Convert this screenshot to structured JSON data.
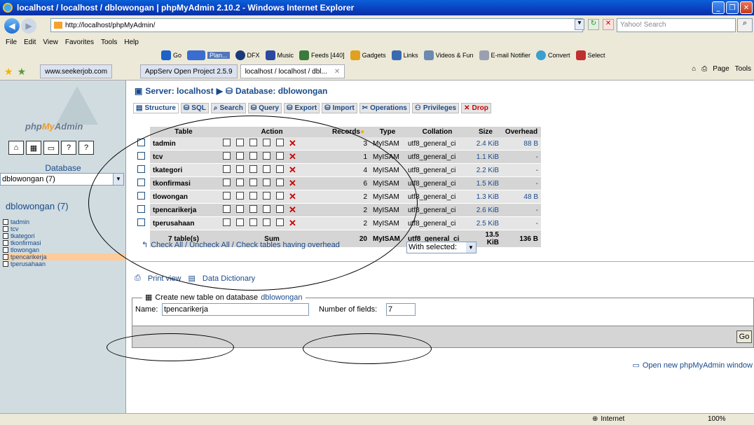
{
  "window": {
    "title": "localhost / localhost / dblowongan | phpMyAdmin 2.10.2 - Windows Internet Explorer"
  },
  "address": {
    "url": "http://localhost/phpMyAdmin/",
    "search_placeholder": "Yahoo! Search"
  },
  "menu": [
    "File",
    "Edit",
    "View",
    "Favorites",
    "Tools",
    "Help"
  ],
  "toolbar": {
    "go": "Go",
    "plan": "Plan...",
    "dfx": "DFX",
    "music": "Music",
    "feeds": "Feeds [440]",
    "gadgets": "Gadgets",
    "links": "Links",
    "videos": "Videos & Fun",
    "email": "E-mail Notifier",
    "convert": "Convert",
    "select": "Select"
  },
  "tabs": [
    {
      "label": "www.seekerjob.com"
    },
    {
      "label": "AppServ Open Project 2.5.9"
    },
    {
      "label": "localhost / localhost / dbl..."
    }
  ],
  "right_tools": {
    "page": "Page",
    "tools": "Tools"
  },
  "left": {
    "logo_php": "php",
    "logo_my": "My",
    "logo_admin": "Admin",
    "database_label": "Database",
    "database_select": "dblowongan (7)",
    "database_title": "dblowongan (7)",
    "tables": [
      "tadmin",
      "tcv",
      "tkategori",
      "tkonfirmasi",
      "tlowongan",
      "tpencarikerja",
      "tperusahaan"
    ],
    "selected_table": "tpencarikerja"
  },
  "main": {
    "breadcrumb": {
      "server": "Server: localhost",
      "arrow": "▶",
      "database": "Database: dblowongan"
    },
    "tabs": [
      "Structure",
      "SQL",
      "Search",
      "Query",
      "Export",
      "Import",
      "Operations",
      "Privileges",
      "Drop"
    ],
    "headers": {
      "table": "Table",
      "action": "Action",
      "records": "Records",
      "type": "Type",
      "collation": "Collation",
      "size": "Size",
      "overhead": "Overhead"
    },
    "rows": [
      {
        "name": "tadmin",
        "records": "3",
        "type": "MyISAM",
        "collation": "utf8_general_ci",
        "size": "2.4 KiB",
        "overhead": "88 B"
      },
      {
        "name": "tcv",
        "records": "1",
        "type": "MyISAM",
        "collation": "utf8_general_ci",
        "size": "1.1 KiB",
        "overhead": "-"
      },
      {
        "name": "tkategori",
        "records": "4",
        "type": "MyISAM",
        "collation": "utf8_general_ci",
        "size": "2.2 KiB",
        "overhead": "-"
      },
      {
        "name": "tkonfirmasi",
        "records": "6",
        "type": "MyISAM",
        "collation": "utf8_general_ci",
        "size": "1.5 KiB",
        "overhead": "-"
      },
      {
        "name": "tlowongan",
        "records": "2",
        "type": "MyISAM",
        "collation": "utf8_general_ci",
        "size": "1.3 KiB",
        "overhead": "48 B"
      },
      {
        "name": "tpencarikerja",
        "records": "2",
        "type": "MyISAM",
        "collation": "utf8_general_ci",
        "size": "2.6 KiB",
        "overhead": "-"
      },
      {
        "name": "tperusahaan",
        "records": "2",
        "type": "MyISAM",
        "collation": "utf8_general_ci",
        "size": "2.5 KiB",
        "overhead": "-"
      }
    ],
    "sum": {
      "count": "7 table(s)",
      "label": "Sum",
      "records": "20",
      "type": "MyISAM",
      "collation": "utf8_general_ci",
      "size": "13.5 KiB",
      "overhead": "136 B"
    },
    "check_all": "Check All / Uncheck All / Check tables having overhead",
    "with_selected": "With selected:",
    "print_view": "Print view",
    "data_dictionary": "Data Dictionary",
    "create_legend": "Create new table on database",
    "create_db": "dblowongan",
    "name_label": "Name:",
    "name_value": "tpencarikerja",
    "num_fields_label": "Number of fields:",
    "num_fields_value": "7",
    "go": "Go",
    "new_window": "Open new phpMyAdmin window"
  },
  "status": {
    "zone": "Internet",
    "zoom": "100%"
  },
  "colors": {
    "link": "#1a4a8a",
    "odd_row": "#e5e5e5",
    "even_row": "#d5d5d5",
    "selected_table": "#ffcc99",
    "drop": "#cc0000"
  }
}
